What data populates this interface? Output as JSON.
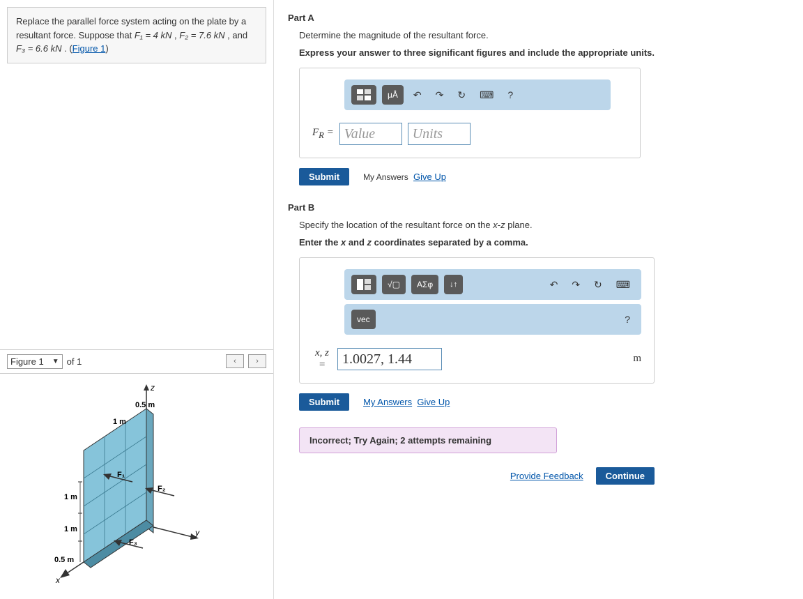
{
  "left": {
    "problem_html_pre": "Replace the parallel force system acting on the plate by a resultant force. Suppose that ",
    "f1lbl": "F₁ = 4 kN",
    "sep1": " , ",
    "f2lbl": "F₂ = 7.6 kN",
    "sep2": " , and ",
    "f3lbl": "F₃ = 6.6 kN",
    "sep3": " . (",
    "figlink": "Figure 1",
    "closep": ")",
    "figure_select": "Figure 1",
    "of": "of 1",
    "prev": "‹",
    "next": "›"
  },
  "figure": {
    "z": "z",
    "y": "y",
    "x": "x",
    "d05a": "0.5 m",
    "d1a": "1 m",
    "d1b": "1 m",
    "d1c": "1 m",
    "d05b": "0.5 m",
    "f1": "F₁",
    "f2": "F₂",
    "f3": "F³"
  },
  "partA": {
    "title": "Part A",
    "desc": "Determine the magnitude of the resultant force.",
    "bold": "Express your answer to three significant figures and include the appropriate units.",
    "label": "F_R =",
    "value_ph": "Value",
    "units_ph": "Units",
    "btn_mu": "μÅ",
    "icon_undo": "↶",
    "icon_redo": "↷",
    "icon_reset": "↻",
    "icon_kb": "⌨",
    "icon_help": "?",
    "submit": "Submit",
    "my_answers": "My Answers",
    "giveup": "Give Up"
  },
  "partB": {
    "title": "Part B",
    "desc": "Specify the location of the resultant force on the x-z plane.",
    "bold": "Enter the x and z coordinates separated by a comma.",
    "btn_sqrt": "√▢",
    "btn_greek": "ΑΣφ",
    "btn_arrows": "↓↑",
    "btn_vec": "vec",
    "icon_undo": "↶",
    "icon_redo": "↷",
    "icon_reset": "↻",
    "icon_kb": "⌨",
    "icon_help": "?",
    "label": "x, z\n=",
    "value": "1.0027, 1.44",
    "unit": "m",
    "submit": "Submit",
    "my_answers": "My Answers",
    "giveup": "Give Up",
    "feedback": "Incorrect; Try Again; 2 attempts remaining"
  },
  "footer": {
    "provide": "Provide Feedback",
    "continue": "Continue"
  }
}
